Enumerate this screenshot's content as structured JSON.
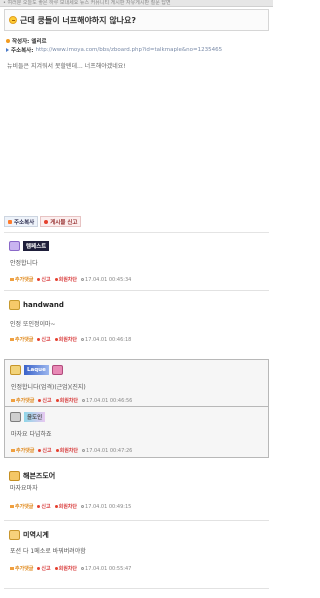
{
  "browser": {
    "top_text": "• 여러분 오늘도 좋은 하루 보내세요  뉴스  커뮤니티  게시판  자유게시판  질문  답변"
  },
  "post": {
    "title": "근데 쿵들이 너프해야하지 않나요?",
    "author_label": "작성자:",
    "author": "엘리르",
    "address_label": "주소복사:",
    "address": "http://www.imoya.com/bbs/zboard.php?id=talkmaple&no=1235465",
    "body": "뉴비들은 지겨워서 못할텐데... 너프해야겠네요!"
  },
  "actions": {
    "share_label": "주소복사",
    "report_label": "게시물 신고"
  },
  "comment_actions": {
    "reply": "추가댓글",
    "report": "신고",
    "block": "회원차단"
  },
  "comments": [
    {
      "name": "템페스트",
      "text": "안정합니다",
      "time": "17.04.01 00:45:34",
      "framed": false
    },
    {
      "name": "handwand",
      "text": "인정 또인정이마~",
      "time": "17.04.01 00:46:18",
      "framed": false
    },
    {
      "name": "Laque",
      "text": "인정합니다(엄격)(근엄)(진지)",
      "time": "17.04.01 00:46:56",
      "framed": true
    },
    {
      "name": "윤도인",
      "text": "마자요 다넘하죠",
      "time": "17.04.01 00:47:26",
      "framed": true
    },
    {
      "name": "해븐즈도어",
      "text": "마자요마자",
      "time": "17.04.01 00:49:15",
      "framed": false
    },
    {
      "name": "미역시계",
      "text": "포션 다 1메소로 바꿔버려야함",
      "time": "17.04.01 00:55:47",
      "framed": false
    }
  ],
  "colors": {
    "accent_orange": "#e0891b",
    "accent_red": "#d83a3a",
    "frame_border": "#b8b8b8"
  }
}
